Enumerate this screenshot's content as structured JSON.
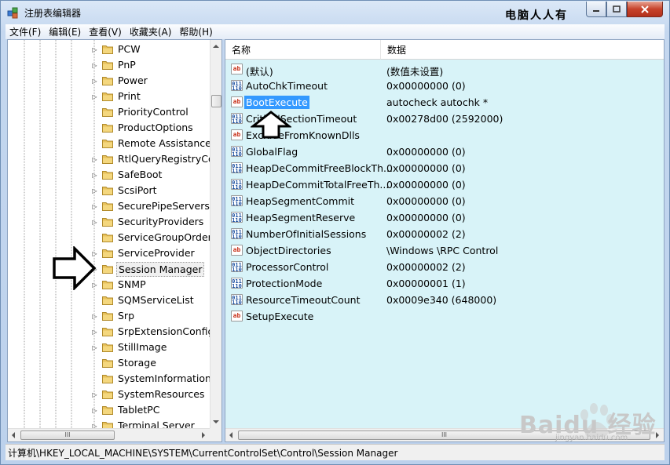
{
  "window": {
    "title": "注册表编辑器",
    "watermark_title": "电脑人人有",
    "buttons": {
      "minimize": "minimize",
      "maximize": "maximize",
      "close": "close"
    }
  },
  "menu": [
    "文件(F)",
    "编辑(E)",
    "查看(V)",
    "收藏夹(A)",
    "帮助(H)"
  ],
  "tree": {
    "items": [
      {
        "label": "PCW",
        "expandable": true
      },
      {
        "label": "PnP",
        "expandable": true
      },
      {
        "label": "Power",
        "expandable": true
      },
      {
        "label": "Print",
        "expandable": true
      },
      {
        "label": "PriorityControl",
        "expandable": false
      },
      {
        "label": "ProductOptions",
        "expandable": false
      },
      {
        "label": "Remote Assistance",
        "expandable": false
      },
      {
        "label": "RtlQueryRegistryCor",
        "expandable": true
      },
      {
        "label": "SafeBoot",
        "expandable": true
      },
      {
        "label": "ScsiPort",
        "expandable": true
      },
      {
        "label": "SecurePipeServers",
        "expandable": true
      },
      {
        "label": "SecurityProviders",
        "expandable": true
      },
      {
        "label": "ServiceGroupOrder",
        "expandable": false
      },
      {
        "label": "ServiceProvider",
        "expandable": true
      },
      {
        "label": "Session Manager",
        "expandable": true,
        "selected": true
      },
      {
        "label": "SNMP",
        "expandable": true
      },
      {
        "label": "SQMServiceList",
        "expandable": false
      },
      {
        "label": "Srp",
        "expandable": true
      },
      {
        "label": "SrpExtensionConfig",
        "expandable": true
      },
      {
        "label": "StillImage",
        "expandable": true
      },
      {
        "label": "Storage",
        "expandable": false
      },
      {
        "label": "SystemInformation",
        "expandable": false
      },
      {
        "label": "SystemResources",
        "expandable": true
      },
      {
        "label": "TabletPC",
        "expandable": true
      },
      {
        "label": "Terminal Server",
        "expandable": true
      }
    ],
    "hscroll_grip": "III"
  },
  "values": {
    "columns": {
      "name": "名称",
      "data": "数据"
    },
    "rows": [
      {
        "icon": "string-value-icon",
        "type": "sz",
        "name": "(默认)",
        "data": "(数值未设置)"
      },
      {
        "icon": "dword-value-icon",
        "type": "dword",
        "name": "AutoChkTimeout",
        "data": "0x00000000 (0)"
      },
      {
        "icon": "string-value-icon",
        "type": "sz",
        "name": "BootExecute",
        "data": "autocheck autochk *",
        "highlight": true
      },
      {
        "icon": "dword-value-icon",
        "type": "dword",
        "name": "CriticalSectionTimeout",
        "data": "0x00278d00 (2592000)"
      },
      {
        "icon": "string-value-icon",
        "type": "sz",
        "name": "ExcludeFromKnownDlls",
        "data": ""
      },
      {
        "icon": "dword-value-icon",
        "type": "dword",
        "name": "GlobalFlag",
        "data": "0x00000000 (0)"
      },
      {
        "icon": "dword-value-icon",
        "type": "dword",
        "name": "HeapDeCommitFreeBlockTh...",
        "data": "0x00000000 (0)"
      },
      {
        "icon": "dword-value-icon",
        "type": "dword",
        "name": "HeapDeCommitTotalFreeTh...",
        "data": "0x00000000 (0)"
      },
      {
        "icon": "dword-value-icon",
        "type": "dword",
        "name": "HeapSegmentCommit",
        "data": "0x00000000 (0)"
      },
      {
        "icon": "dword-value-icon",
        "type": "dword",
        "name": "HeapSegmentReserve",
        "data": "0x00000000 (0)"
      },
      {
        "icon": "dword-value-icon",
        "type": "dword",
        "name": "NumberOfInitialSessions",
        "data": "0x00000002 (2)"
      },
      {
        "icon": "string-value-icon",
        "type": "sz",
        "name": "ObjectDirectories",
        "data": "\\Windows \\RPC Control"
      },
      {
        "icon": "dword-value-icon",
        "type": "dword",
        "name": "ProcessorControl",
        "data": "0x00000002 (2)"
      },
      {
        "icon": "dword-value-icon",
        "type": "dword",
        "name": "ProtectionMode",
        "data": "0x00000001 (1)"
      },
      {
        "icon": "dword-value-icon",
        "type": "dword",
        "name": "ResourceTimeoutCount",
        "data": "0x0009e340 (648000)"
      },
      {
        "icon": "string-value-icon",
        "type": "sz",
        "name": "SetupExecute",
        "data": ""
      }
    ],
    "hscroll_grip": "III",
    "icon_text": {
      "sz": "ab",
      "dword": "011\n110"
    }
  },
  "status": "计算机\\HKEY_LOCAL_MACHINE\\SYSTEM\\CurrentControlSet\\Control\\Session Manager",
  "watermark": {
    "brand": "Baidu 经验",
    "sub": "jingyan.baidu.com"
  },
  "colors": {
    "highlight": "#3399ff",
    "pane_bg": "#d8f3f8",
    "folder": "#e8c15a"
  }
}
